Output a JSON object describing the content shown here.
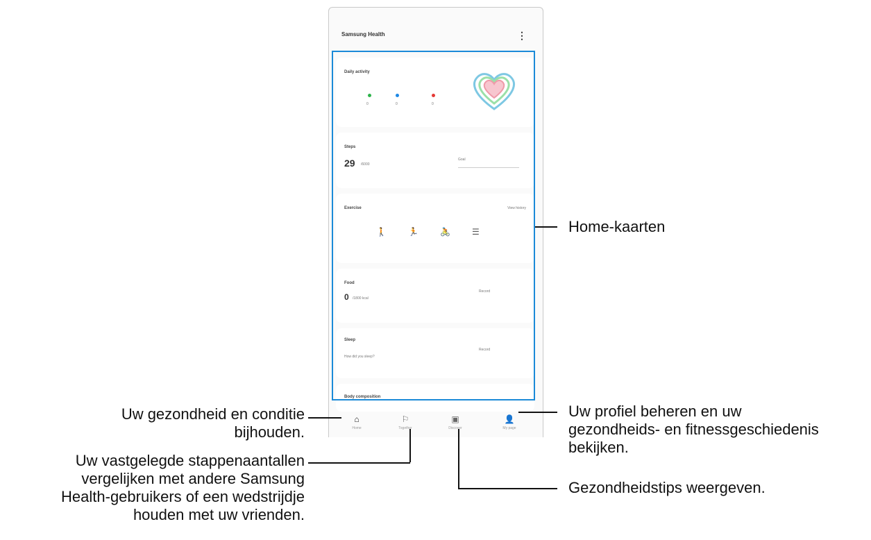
{
  "app": {
    "title": "Samsung Health",
    "more_icon": "more-vertical-icon"
  },
  "cards": {
    "daily_activity": {
      "title": "Daily activity",
      "metrics": [
        "0",
        "0",
        "0"
      ],
      "colors": [
        "#2db34a",
        "#1e88e5",
        "#e53935"
      ]
    },
    "steps": {
      "title": "Steps",
      "value": "29",
      "target": "/6000",
      "chart_label": "Goal"
    },
    "exercise": {
      "title": "Exercise",
      "action": "View history"
    },
    "food": {
      "title": "Food",
      "value": "0",
      "target": "/1800 kcal",
      "action": "Record"
    },
    "sleep": {
      "title": "Sleep",
      "question": "How did you sleep?",
      "action": "Record"
    },
    "body": {
      "title": "Body composition"
    }
  },
  "nav": [
    {
      "icon": "home-icon",
      "label": "Home"
    },
    {
      "icon": "together-icon",
      "label": "Together"
    },
    {
      "icon": "discover-icon",
      "label": "Discover"
    },
    {
      "icon": "my-page-icon",
      "label": "My page"
    }
  ],
  "callouts": {
    "home_cards": "Home-kaarten",
    "home_1": "Uw gezondheid en conditie",
    "home_2": "bijhouden.",
    "together_1": "Uw vastgelegde stappenaantallen",
    "together_2": "vergelijken met andere Samsung",
    "together_3": "Health-gebruikers of een wedstrijdje",
    "together_4": "houden met uw vrienden.",
    "discover_1": "Gezondheidstips weergeven.",
    "mypage_1": "Uw profiel beheren en uw",
    "mypage_2": "gezondheids- en fitnessgeschiedenis",
    "mypage_3": "bekijken."
  },
  "colors": {
    "accent": "#1b8ad8"
  }
}
